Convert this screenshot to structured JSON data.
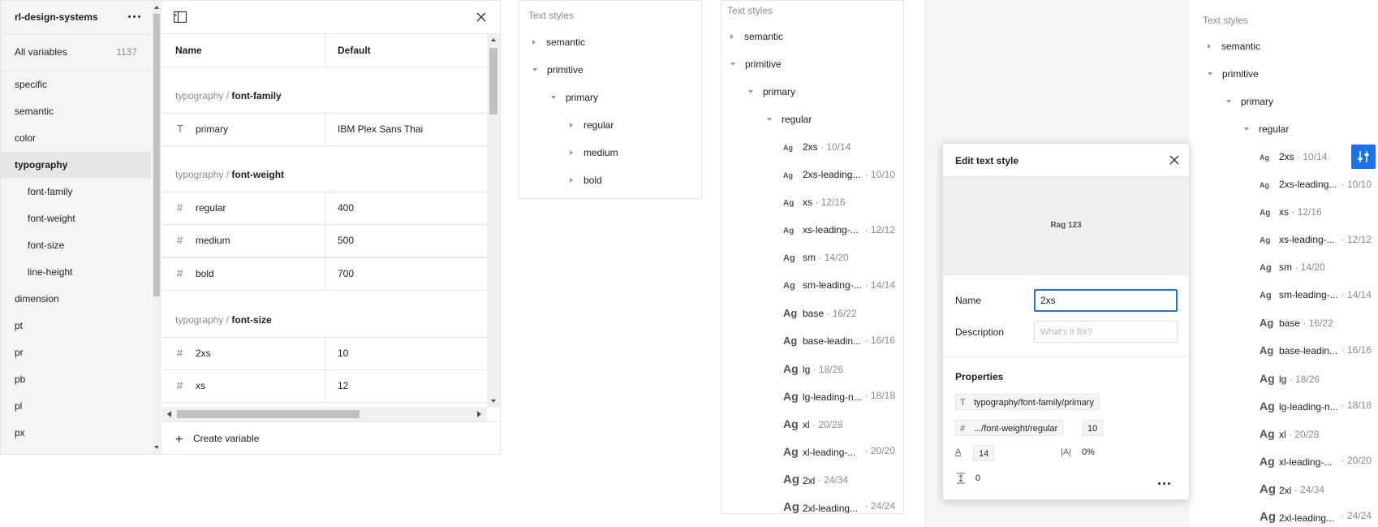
{
  "variables_panel": {
    "collection": "rl-design-systems",
    "all_variables": {
      "label": "All variables",
      "count": "1137"
    },
    "groups": [
      "specific",
      "semantic",
      "color",
      "typography",
      "font-family",
      "font-weight",
      "font-size",
      "line-height",
      "dimension",
      "pt",
      "pr",
      "pb",
      "pl",
      "px"
    ],
    "active_group": "typography",
    "columns": {
      "name": "Name",
      "default": "Default"
    },
    "sections": [
      {
        "prefix": "typography / ",
        "name": "font-family",
        "rows": [
          {
            "icon": "T",
            "name": "primary",
            "value": "IBM Plex Sans Thai"
          }
        ]
      },
      {
        "prefix": "typography / ",
        "name": "font-weight",
        "rows": [
          {
            "icon": "#",
            "name": "regular",
            "value": "400"
          },
          {
            "icon": "#",
            "name": "medium",
            "value": "500"
          },
          {
            "icon": "#",
            "name": "bold",
            "value": "700"
          }
        ]
      },
      {
        "prefix": "typography / ",
        "name": "font-size",
        "rows": [
          {
            "icon": "#",
            "name": "2xs",
            "value": "10"
          },
          {
            "icon": "#",
            "name": "xs",
            "value": "12"
          }
        ]
      }
    ],
    "create_label": "Create variable"
  },
  "tree_small": {
    "title": "Text styles",
    "items": [
      "semantic",
      "primitive",
      "primary",
      "regular",
      "medium",
      "bold"
    ]
  },
  "tree_expanded": {
    "title": "Text styles",
    "folders": [
      "semantic",
      "primitive",
      "primary",
      "regular"
    ],
    "styles": [
      {
        "name": "2xs",
        "size": "10/14"
      },
      {
        "name": "2xs-leading...",
        "size": "10/10"
      },
      {
        "name": "xs",
        "size": "12/16"
      },
      {
        "name": "xs-leading-...",
        "size": "12/12"
      },
      {
        "name": "sm",
        "size": "14/20"
      },
      {
        "name": "sm-leading-...",
        "size": "14/14"
      },
      {
        "name": "base",
        "size": "16/22"
      },
      {
        "name": "base-leadin...",
        "size": "16/16"
      },
      {
        "name": "lg",
        "size": "18/26"
      },
      {
        "name": "lg-leading-n...",
        "size": "18/18"
      },
      {
        "name": "xl",
        "size": "20/28"
      },
      {
        "name": "xl-leading-...",
        "size": "20/20"
      },
      {
        "name": "2xl",
        "size": "24/34"
      },
      {
        "name": "2xl-leading...",
        "size": "24/24"
      }
    ]
  },
  "tree_right": {
    "title": "Text styles",
    "folders": [
      "semantic",
      "primitive",
      "primary",
      "regular"
    ],
    "styles": [
      {
        "name": "2xs",
        "size": "10/14"
      },
      {
        "name": "2xs-leading...",
        "size": "10/10"
      },
      {
        "name": "xs",
        "size": "12/16"
      },
      {
        "name": "xs-leading-...",
        "size": "12/12"
      },
      {
        "name": "sm",
        "size": "14/20"
      },
      {
        "name": "sm-leading-...",
        "size": "14/14"
      },
      {
        "name": "base",
        "size": "16/22"
      },
      {
        "name": "base-leadin...",
        "size": "16/16"
      },
      {
        "name": "lg",
        "size": "18/26"
      },
      {
        "name": "lg-leading-n...",
        "size": "18/18"
      },
      {
        "name": "xl",
        "size": "20/28"
      },
      {
        "name": "xl-leading-...",
        "size": "20/20"
      },
      {
        "name": "2xl",
        "size": "24/34"
      },
      {
        "name": "2xl-leading...",
        "size": "24/24"
      }
    ]
  },
  "ag_label": "Ag",
  "size_separator": "·",
  "dialog": {
    "title": "Edit text style",
    "preview_text": "Rag 123",
    "name_label": "Name",
    "name_value": "2xs",
    "description_label": "Description",
    "description_placeholder": "What's it for?",
    "properties_label": "Properties",
    "font_family": "typography/font-family/primary",
    "font_weight": ".../font-weight/regular",
    "font_weight_value": "10",
    "font_size": "14",
    "letter_spacing": "0%",
    "paragraph_spacing": "0"
  },
  "colors": {
    "accent": "#1a73e8",
    "sidebar_bg": "#f5f5f5",
    "active_bg": "#e6e6e6"
  }
}
